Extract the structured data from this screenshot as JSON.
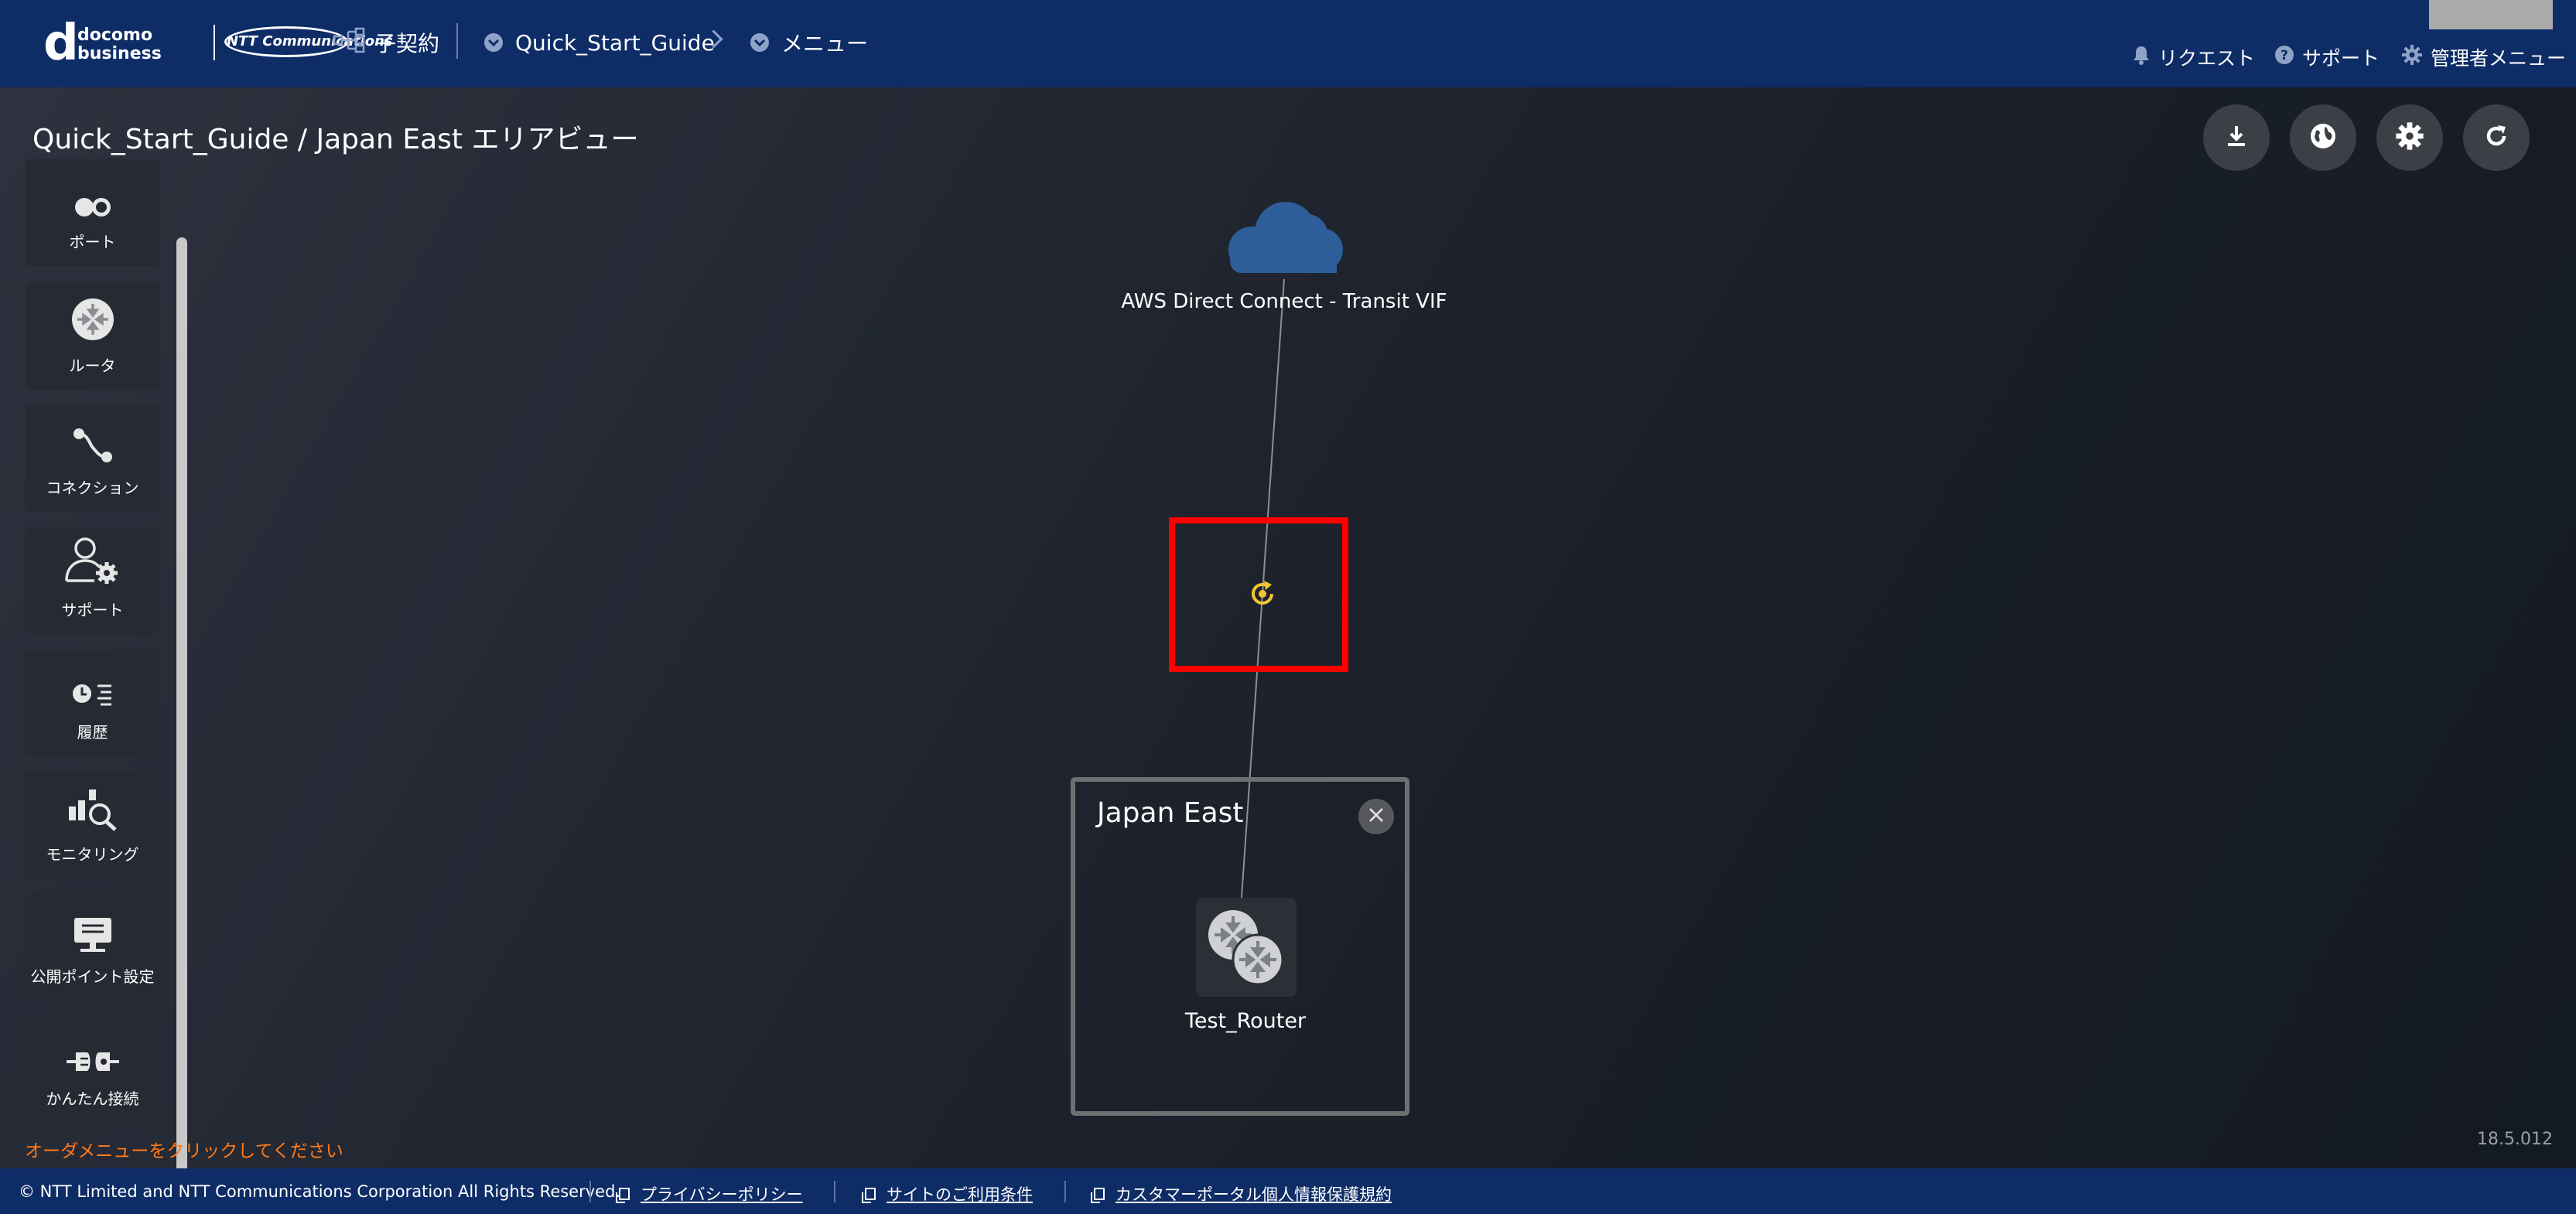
{
  "header": {
    "logo_mark": "d",
    "logo_words_1": "docomo",
    "logo_words_2": "business",
    "logo_ntt": "NTT Communications",
    "contract_label": "子契約",
    "breadcrumb_1": "Quick_Start_Guide",
    "breadcrumb_2": "メニュー",
    "request_label": "リクエスト",
    "support_label": "サポート",
    "admin_label": "管理者メニュー"
  },
  "page": {
    "title": "Quick_Start_Guide / Japan East エリアビュー"
  },
  "toolbar": {
    "icons": [
      "download-icon",
      "globe-icon",
      "gear-icon",
      "refresh-icon"
    ]
  },
  "sidebar": {
    "items": [
      {
        "label": "ポート",
        "icon": "port-icon"
      },
      {
        "label": "ルータ",
        "icon": "router-icon"
      },
      {
        "label": "コネクション",
        "icon": "connection-icon"
      },
      {
        "label": "サポート",
        "icon": "support-user-gear-icon"
      },
      {
        "label": "履歴",
        "icon": "history-icon"
      },
      {
        "label": "モニタリング",
        "icon": "monitoring-icon"
      },
      {
        "label": "公開ポイント設定",
        "icon": "public-point-icon"
      },
      {
        "label": "かんたん接続",
        "icon": "easy-connect-icon"
      }
    ],
    "order_hint": "オーダメニューをクリックしてください"
  },
  "canvas": {
    "cloud_label": "AWS Direct Connect - Transit VIF",
    "area_title": "Japan East",
    "router_label": "Test_Router",
    "connection_status_color": "#f2c531",
    "highlight_color": "#ff0000"
  },
  "version": "18.5.012",
  "footer": {
    "copyright": "© NTT Limited and NTT Communications Corporation All Rights Reserved.",
    "privacy_link": "プライバシーポリシー",
    "terms_link": "サイトのご利用条件",
    "portal_privacy_link": "カスタマーポータル個人情報保護規約"
  }
}
